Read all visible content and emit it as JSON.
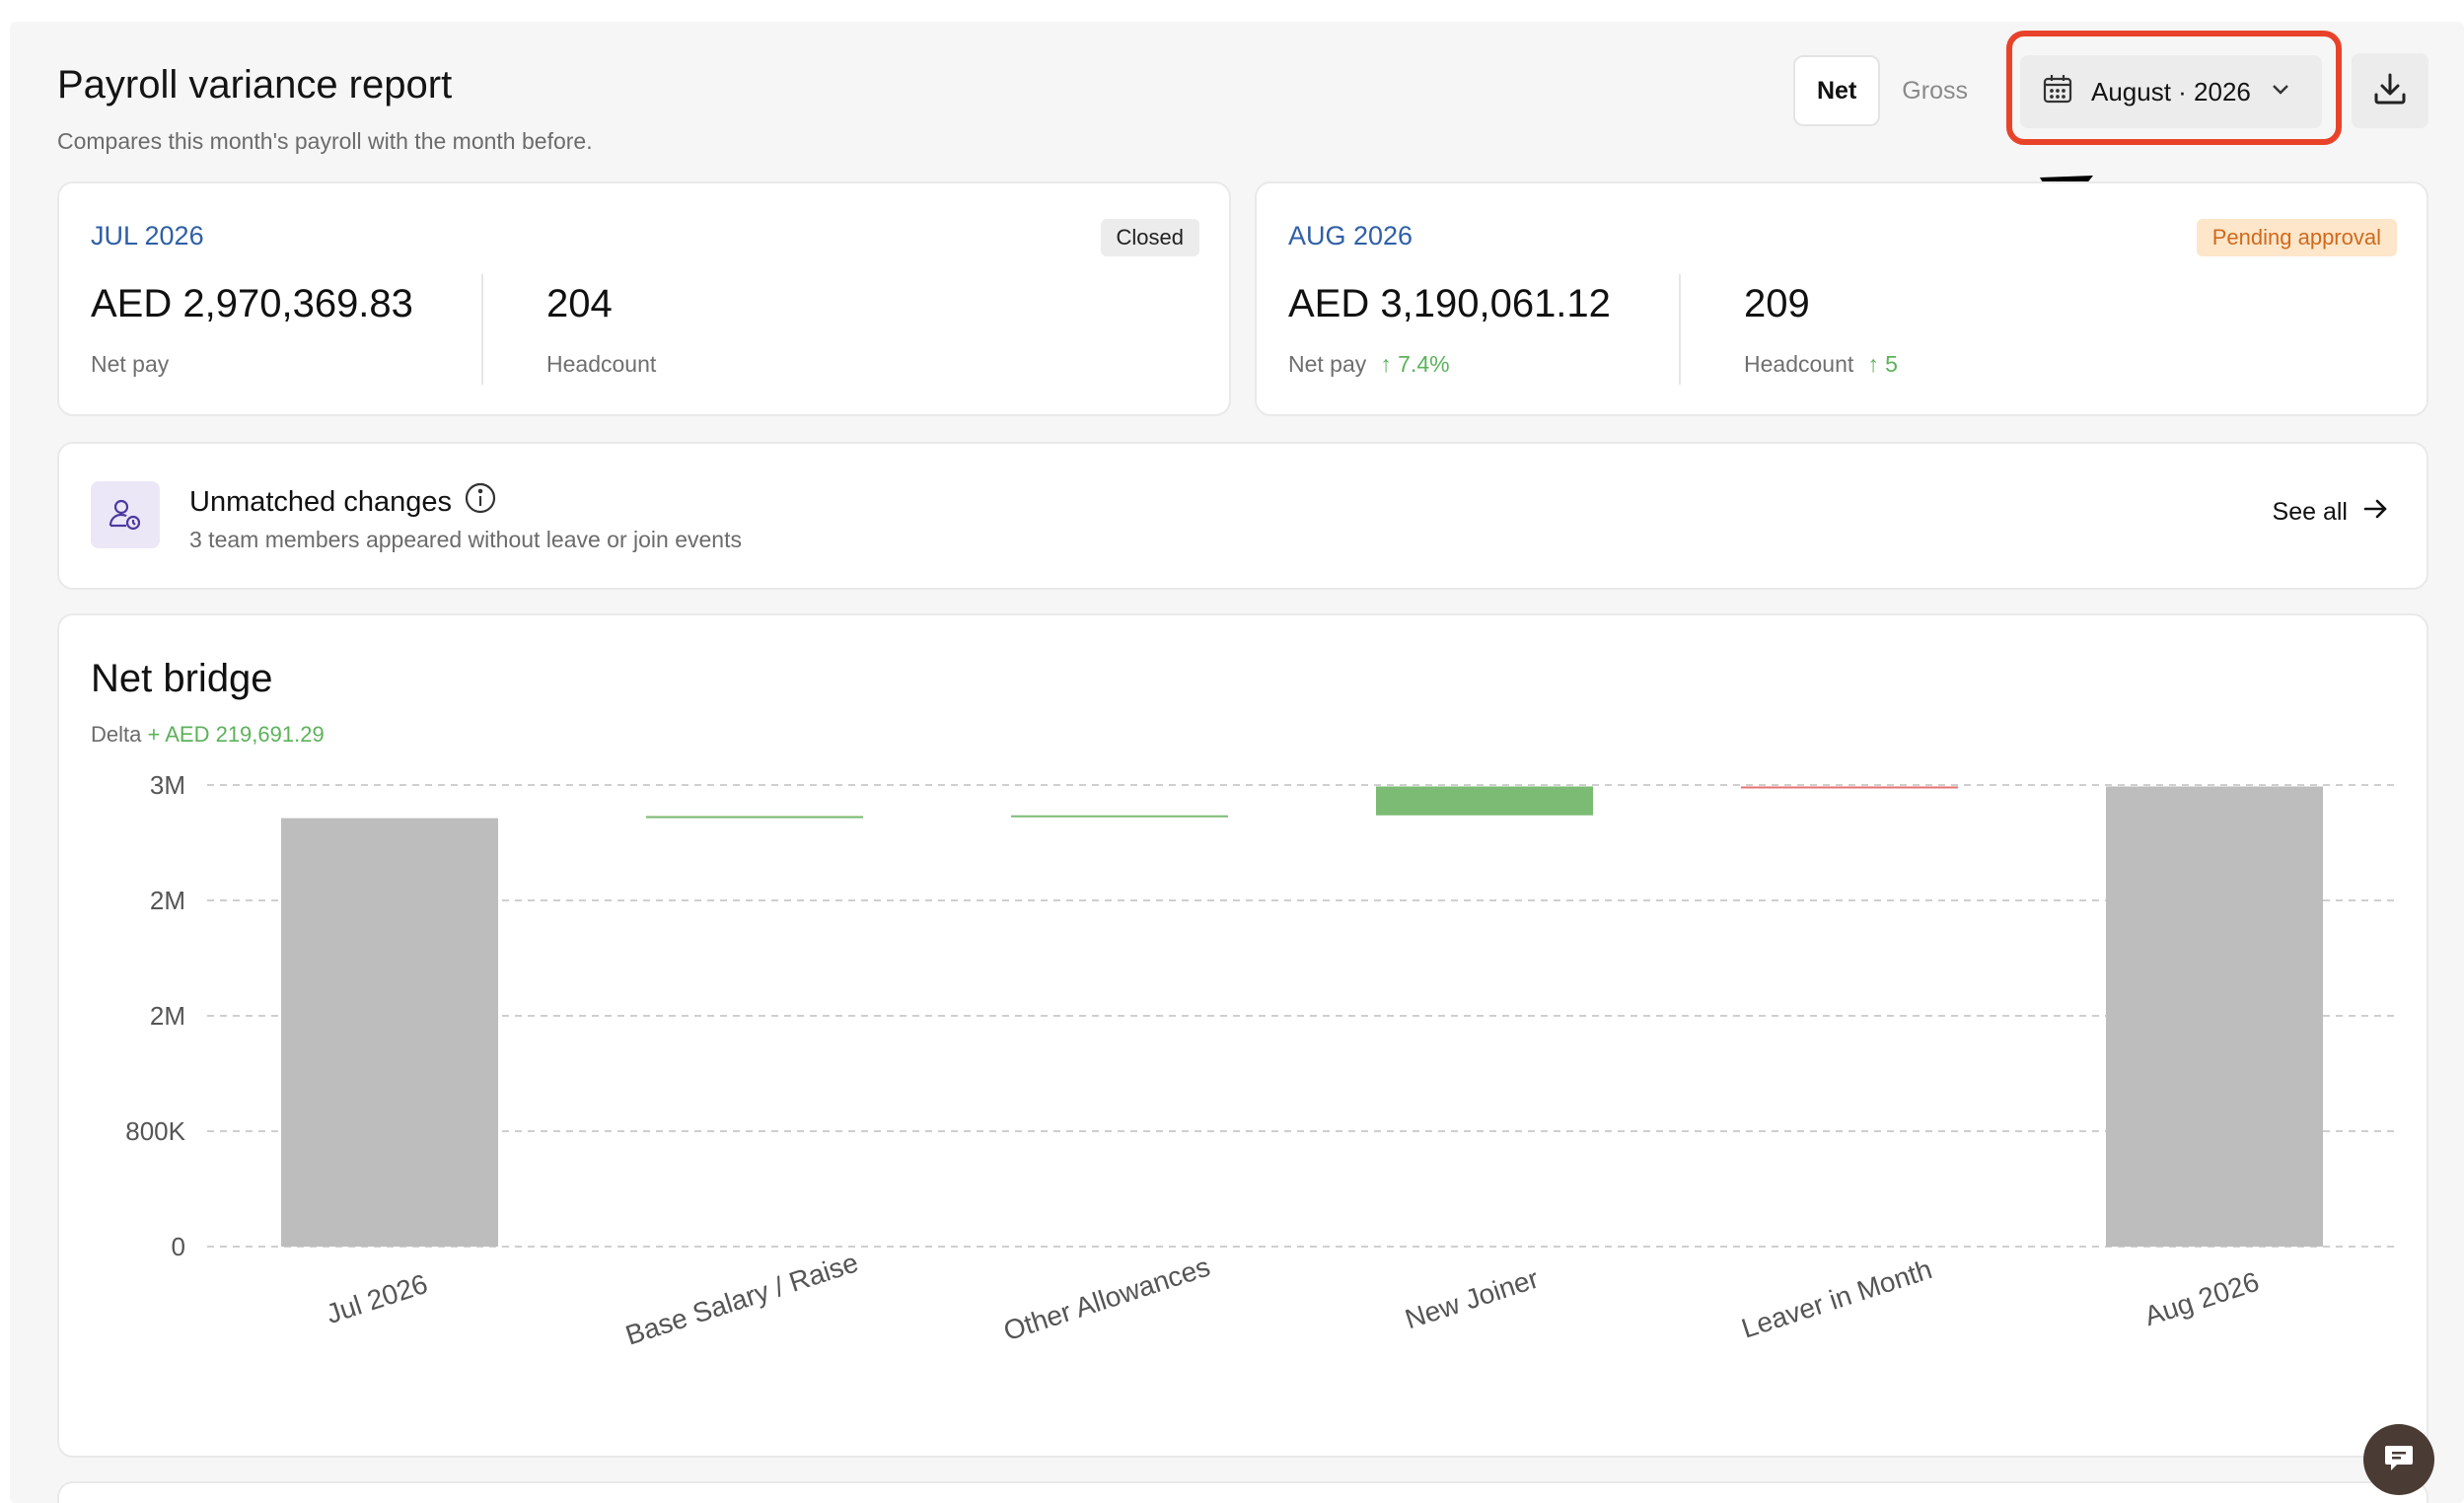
{
  "header": {
    "title": "Payroll variance report",
    "subtitle": "Compares this month's payroll with the month before.",
    "toggle": {
      "net_label": "Net",
      "gross_label": "Gross",
      "selected": "Net"
    },
    "date_selector": {
      "label": "August · 2026",
      "icon": "calendar-icon"
    },
    "download": {
      "icon": "download-icon"
    }
  },
  "periods": [
    {
      "label": "JUL 2026",
      "badge": "Closed",
      "net_pay": "AED 2,970,369.83",
      "net_pay_label": "Net pay",
      "net_pay_delta": "",
      "headcount": "204",
      "headcount_label": "Headcount",
      "headcount_delta": ""
    },
    {
      "label": "AUG 2026",
      "badge": "Pending approval",
      "net_pay": "AED 3,190,061.12",
      "net_pay_label": "Net pay",
      "net_pay_delta": "↑ 7.4%",
      "headcount": "209",
      "headcount_label": "Headcount",
      "headcount_delta": "↑ 5"
    }
  ],
  "unmatched": {
    "title": "Unmatched changes",
    "subtitle": "3 team members appeared without leave or join events",
    "see_all": "See all"
  },
  "bridge": {
    "title": "Net bridge",
    "delta_label": "Delta",
    "delta_value": "+ AED 219,691.29"
  },
  "colors": {
    "accent_link": "#2f5fa6",
    "positive": "#5cb25a",
    "pending_bg": "#fde6c9",
    "pending_text": "#d0691c",
    "highlight": "#e8432a",
    "bar_total": "#bdbdbd",
    "bar_increase": "#7cbb74"
  },
  "chart_data": {
    "type": "bar",
    "subtype": "waterfall",
    "categories": [
      "Jul 2026",
      "Base Salary / Raise",
      "Other Allowances",
      "New Joiner",
      "Leaver in Month",
      "Aug 2026"
    ],
    "y_tick_labels": [
      "3M",
      "2M",
      "2M",
      "800K",
      "0"
    ],
    "ylim": [
      0,
      3200000
    ],
    "grid": true,
    "bars": [
      {
        "category": "Jul 2026",
        "kind": "total",
        "start": 0,
        "end": 2970369.83
      },
      {
        "category": "Base Salary / Raise",
        "kind": "increase",
        "start": 2970369.83,
        "end": 2985000
      },
      {
        "category": "Other Allowances",
        "kind": "increase",
        "start": 2985000,
        "end": 2990000
      },
      {
        "category": "New Joiner",
        "kind": "increase",
        "start": 2990000,
        "end": 3190061.12
      },
      {
        "category": "Leaver in Month",
        "kind": "decrease",
        "start": 3190061.12,
        "end": 3190061.12
      },
      {
        "category": "Aug 2026",
        "kind": "total",
        "start": 0,
        "end": 3190061.12
      }
    ]
  }
}
